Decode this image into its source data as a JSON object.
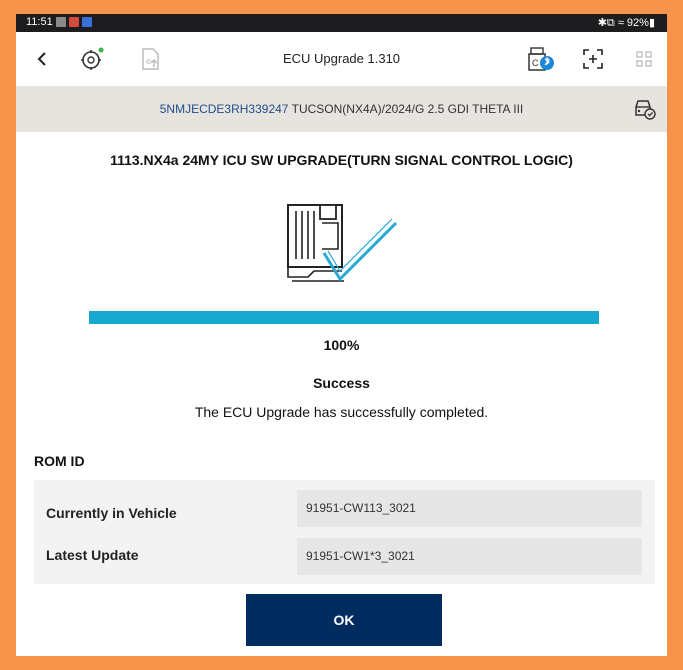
{
  "status_bar": {
    "time": "11:51",
    "right": "✱⧉ ≈ 92%▮"
  },
  "app_bar": {
    "title": "ECU Upgrade 1.310",
    "icons": [
      "back-chevron-icon",
      "vehicle-settings-icon",
      "ecu-upload-icon",
      "bluetooth-adapter-icon",
      "screen-capture-icon",
      "grid-menu-icon"
    ]
  },
  "vehicle": {
    "vin": "5NMJECDE3RH339247",
    "description": "TUCSON(NX4A)/2024/G 2.5 GDI THETA III"
  },
  "upgrade": {
    "title": "1113.NX4a 24MY ICU SW UPGRADE(TURN SIGNAL CONTROL LOGIC)",
    "progress_text": "100%",
    "progress_fraction": 1.0,
    "status": "Success",
    "message": "The ECU Upgrade has successfully completed."
  },
  "rom": {
    "label": "ROM ID",
    "rows": [
      {
        "label": "Currently in Vehicle",
        "value": "91951-CW113_3021"
      },
      {
        "label": "Latest Update",
        "value": "91951-CW1*3_3021"
      }
    ]
  },
  "actions": {
    "ok_label": "OK"
  },
  "colors": {
    "frame": "#f7934a",
    "accent_progress": "#19a9cf",
    "button": "#002c5f",
    "vin_text": "#1f4e8c"
  }
}
